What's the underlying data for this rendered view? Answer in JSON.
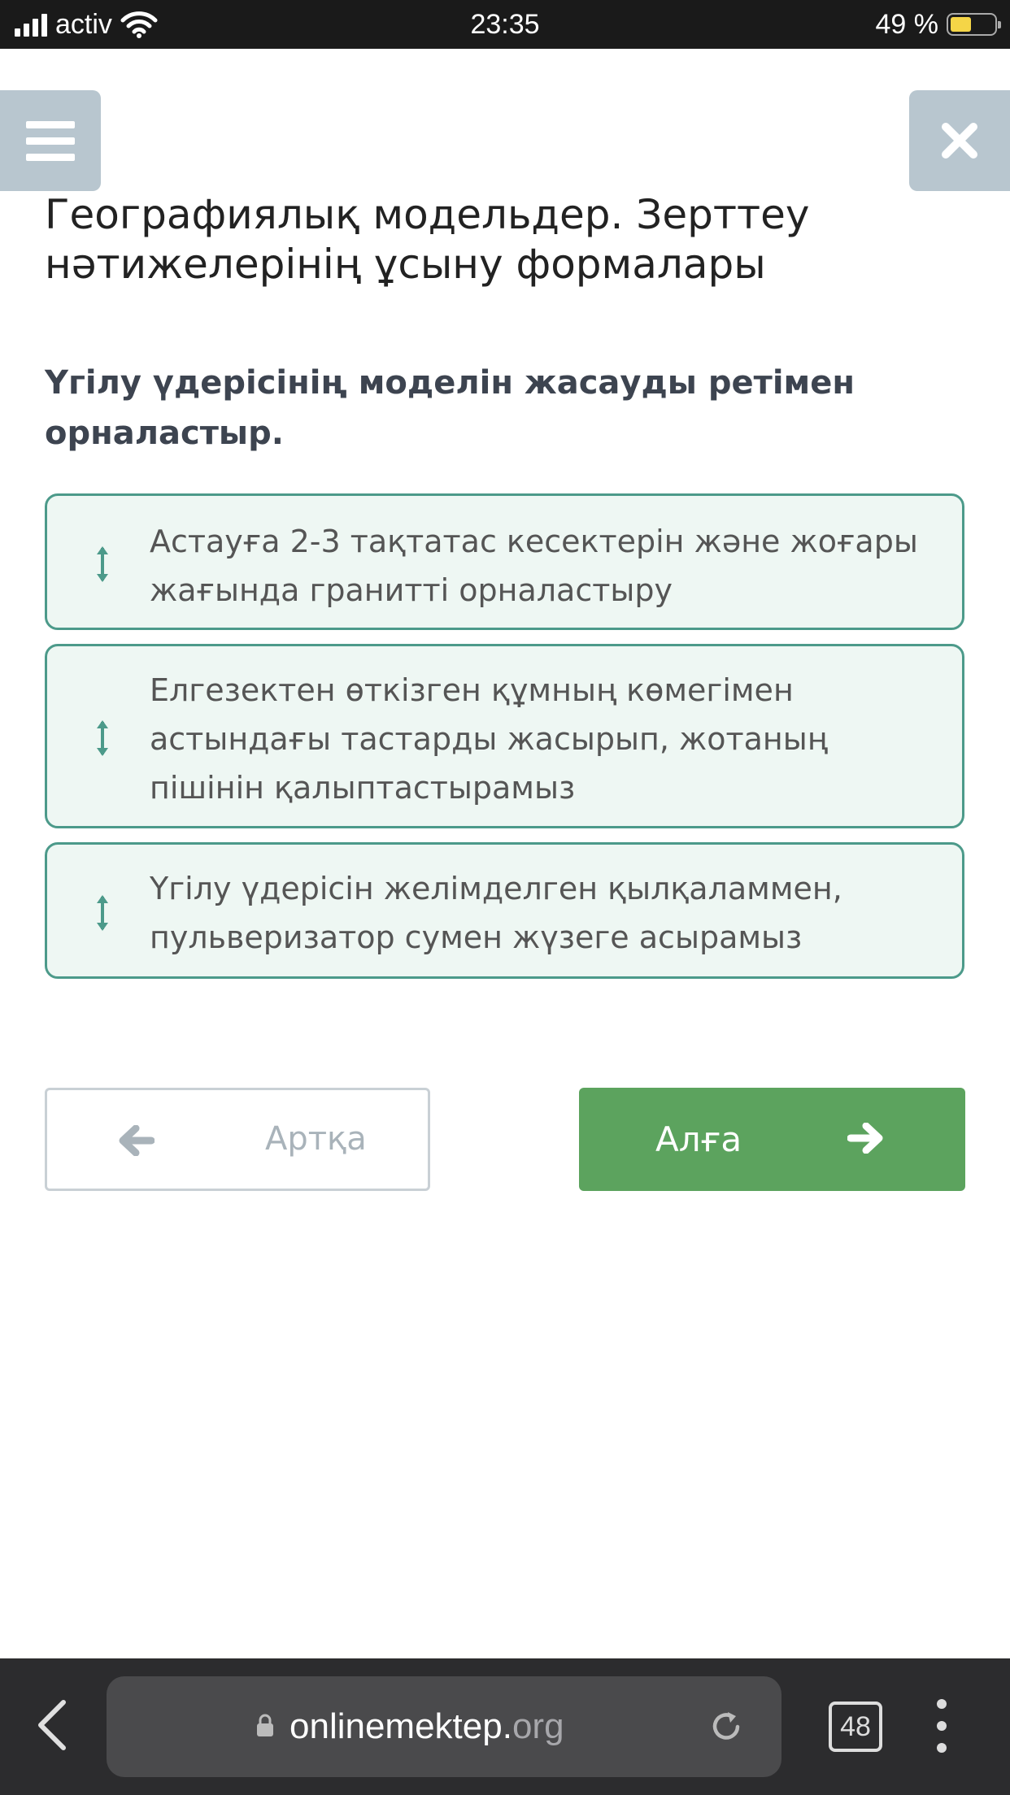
{
  "status_bar": {
    "carrier": "activ",
    "time": "23:35",
    "battery": "49 %",
    "battery_level": 0.49
  },
  "header": {
    "menu_icon": "hamburger-menu-icon",
    "close_icon": "close-icon",
    "title": "Географиялық модельдер. Зерттеу нәтижелерінің ұсыну формалары"
  },
  "question": {
    "text": "Үгілу үдерісінің моделін жасауды ретімен орналастыр."
  },
  "items": [
    {
      "text": "Астауға 2-3 тақтатас кесектерін және жоғары жағында гранитті орналастыру"
    },
    {
      "text": "Елгезектен өткізген құмның көмегімен астындағы тастарды жасырып, жотаның пішінін қалыптастырамыз"
    },
    {
      "text": "Үгілу үдерісін желімделген қылқаламмен, пульверизатор сумен жүзеге асырамыз"
    }
  ],
  "navigation": {
    "back_label": "Артқа",
    "next_label": "Алға"
  },
  "browser": {
    "url_main": "onlinemektep.",
    "url_tld": "org",
    "tab_count": "48"
  },
  "colors": {
    "card_bg": "#eef7f3",
    "card_border": "#4c9a8a",
    "next_button": "#5ca35e",
    "menu_buttons": "#b8c6cf"
  }
}
